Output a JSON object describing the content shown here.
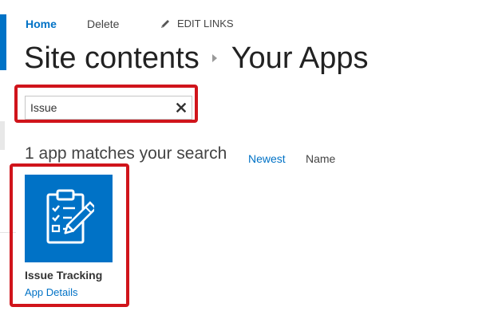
{
  "nav": {
    "home": "Home",
    "delete": "Delete",
    "edit_links": "EDIT LINKS"
  },
  "title": {
    "part1": "Site contents",
    "part2": "Your Apps"
  },
  "search": {
    "value": "Issue"
  },
  "results": {
    "count_text": "1 app matches your search",
    "sort_newest": "Newest",
    "sort_name": "Name"
  },
  "apps": [
    {
      "name": "Issue Tracking",
      "details_link": "App Details",
      "icon": "clipboard-checklist-icon"
    }
  ],
  "colors": {
    "accent": "#0072c6",
    "highlight": "#d0141b"
  }
}
